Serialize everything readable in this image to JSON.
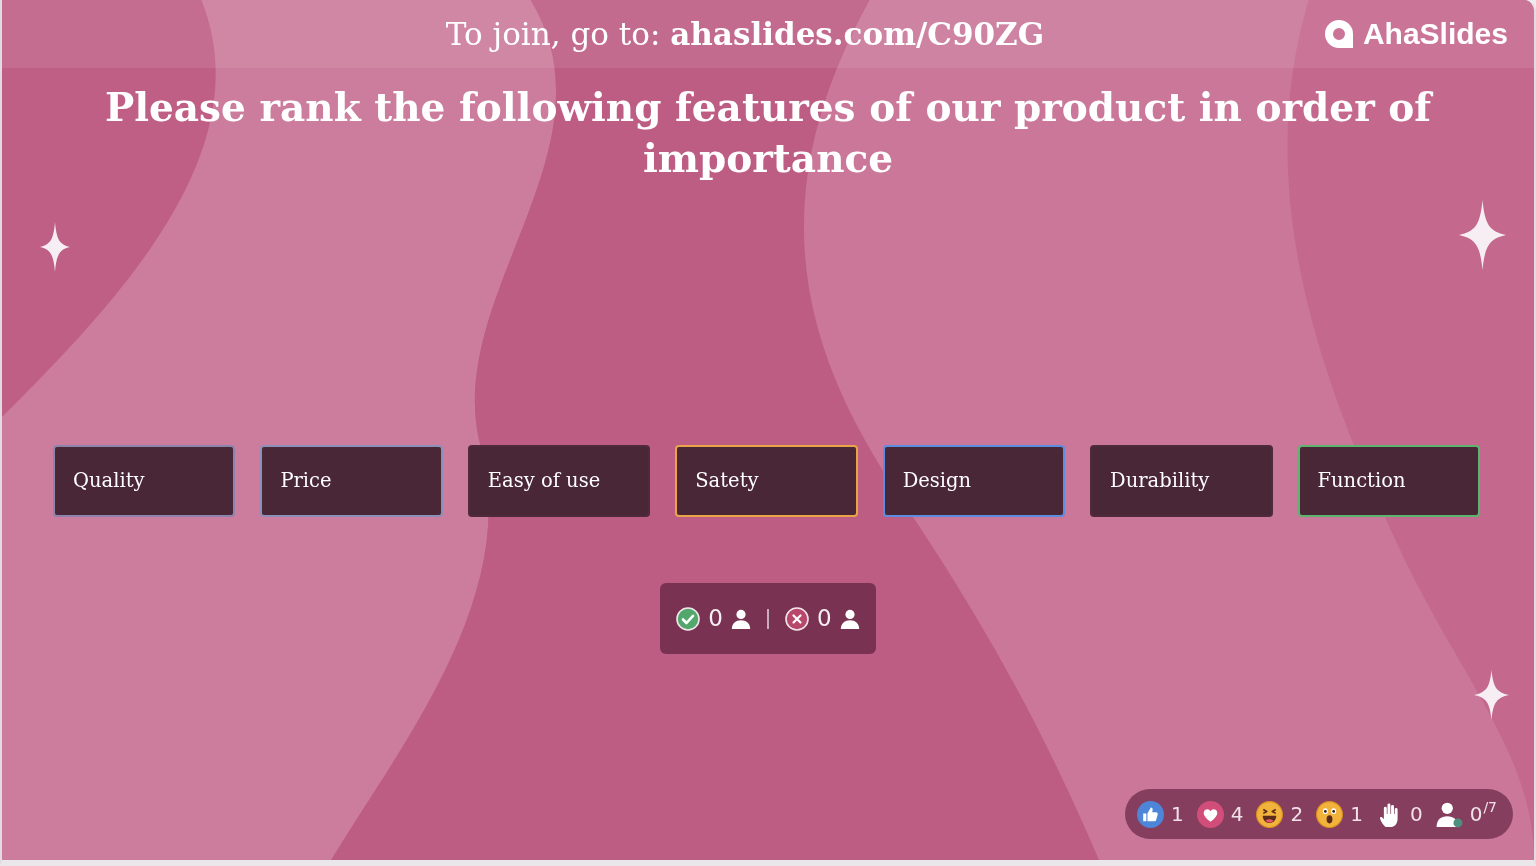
{
  "header": {
    "join_text": "To join, go to: **ahaslides.com/C90ZG**",
    "logo": "AhaSlides"
  },
  "question": "Please rank the following features of our product in order of importance",
  "options": [
    {
      "label": "Quality",
      "color": "#8c84aa"
    },
    {
      "label": "Price",
      "color": "#8c90b8"
    },
    {
      "label": "Easy of use",
      "color": "#4e2a3b"
    },
    {
      "label": "Satety",
      "color": "#e8a447"
    },
    {
      "label": "Design",
      "color": "#5b8ee0"
    },
    {
      "label": "Durability",
      "color": "#4e2a3b"
    },
    {
      "label": "Function",
      "color": "#5cb46e"
    }
  ],
  "results": {
    "correct_count": "0",
    "incorrect_count": "0"
  },
  "reactions": [
    {
      "kind": "like",
      "count": "1"
    },
    {
      "kind": "heart",
      "count": "4"
    },
    {
      "kind": "laugh",
      "count": "2"
    },
    {
      "kind": "wow",
      "count": "1"
    },
    {
      "kind": "hand",
      "count": "0"
    }
  ],
  "audience": {
    "count": "0",
    "capacity": "/7"
  }
}
